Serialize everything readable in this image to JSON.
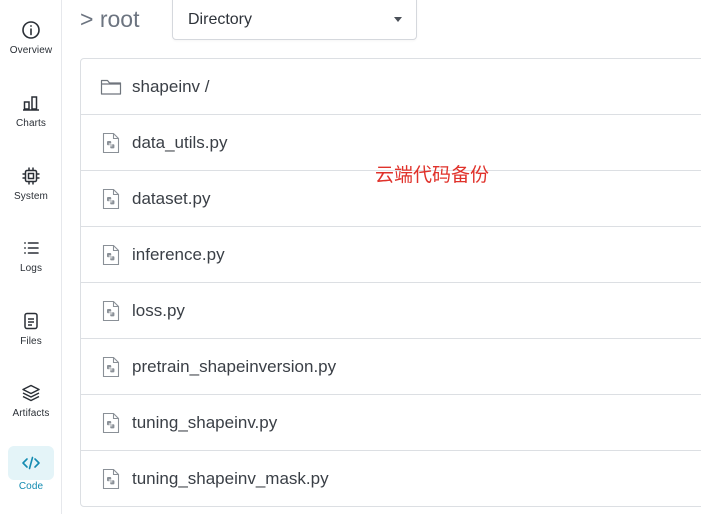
{
  "sidebar": {
    "items": [
      {
        "label": "Overview",
        "icon": "info-icon",
        "active": false
      },
      {
        "label": "Charts",
        "icon": "bar-chart-icon",
        "active": false
      },
      {
        "label": "System",
        "icon": "chip-icon",
        "active": false
      },
      {
        "label": "Logs",
        "icon": "list-icon",
        "active": false
      },
      {
        "label": "Files",
        "icon": "file-icon",
        "active": false
      },
      {
        "label": "Artifacts",
        "icon": "layers-icon",
        "active": false
      },
      {
        "label": "Code",
        "icon": "code-icon",
        "active": true
      }
    ],
    "active_color": "#138bb1",
    "active_bg": "#e4f4f8"
  },
  "header": {
    "breadcrumb": "> root",
    "view_select": {
      "value": "Directory"
    }
  },
  "files": [
    {
      "name": "shapeinv /",
      "type": "folder"
    },
    {
      "name": "data_utils.py",
      "type": "python"
    },
    {
      "name": "dataset.py",
      "type": "python"
    },
    {
      "name": "inference.py",
      "type": "python"
    },
    {
      "name": "loss.py",
      "type": "python"
    },
    {
      "name": "pretrain_shapeinversion.py",
      "type": "python"
    },
    {
      "name": "tuning_shapeinv.py",
      "type": "python"
    },
    {
      "name": "tuning_shapeinv_mask.py",
      "type": "python"
    }
  ],
  "overlay_text": "云端代码备份",
  "overlay_color": "#e0322b"
}
